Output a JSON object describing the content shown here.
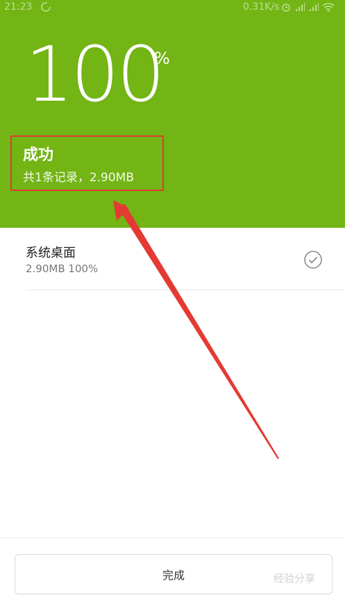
{
  "status_bar": {
    "time": "21:23",
    "network_speed": "0.31K/s"
  },
  "progress": {
    "value": "100",
    "unit": "%"
  },
  "result": {
    "title": "成功",
    "summary": "共1条记录，2.90MB"
  },
  "items": [
    {
      "name": "系统桌面",
      "detail": "2.90MB 100%",
      "checked": true
    }
  ],
  "done_button": {
    "label": "完成"
  },
  "watermark": "经验分享",
  "colors": {
    "header_bg": "#72b514",
    "highlight_box": "#e33b33",
    "arrow": "#e33b33"
  }
}
